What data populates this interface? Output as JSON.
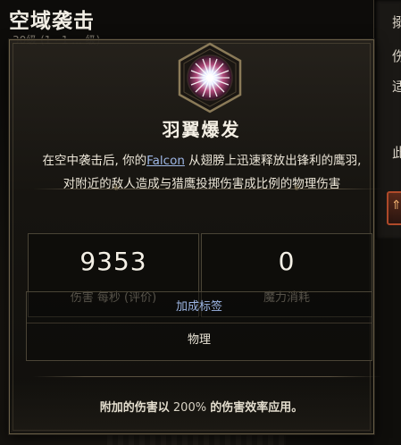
{
  "background": {
    "title": "空域袭击",
    "subtitle": "30级 (1 · 1 ... 级)",
    "right_glyphs": [
      "搦",
      "伤",
      "适",
      "此"
    ]
  },
  "tooltip": {
    "skill_name": "羽翼爆发",
    "description_before": "在空中袭击后, 你的",
    "description_keyword": "Falcon",
    "description_after": " 从翅膀上迅速释放出锋利的鹰羽, 对附近的敌人造成与猎鹰投掷伤害成比例的物理伤害",
    "stats": [
      {
        "value": "9353",
        "label": "伤害 每秒 (评价)"
      },
      {
        "value": "0",
        "label": "魔力消耗"
      }
    ],
    "tags_header": "加成标签",
    "tags": [
      "物理"
    ],
    "footer_before": "附加的伤害以",
    "footer_percent": " 200% ",
    "footer_after": "的伤害效率应用。"
  },
  "colors": {
    "keyword": "#9db6e4",
    "border": "#6b6048",
    "emblem_core": "#e7ecff"
  },
  "icons": [
    "skill-emblem-icon",
    "divider-ornament-icon",
    "skill-slot-icon"
  ]
}
